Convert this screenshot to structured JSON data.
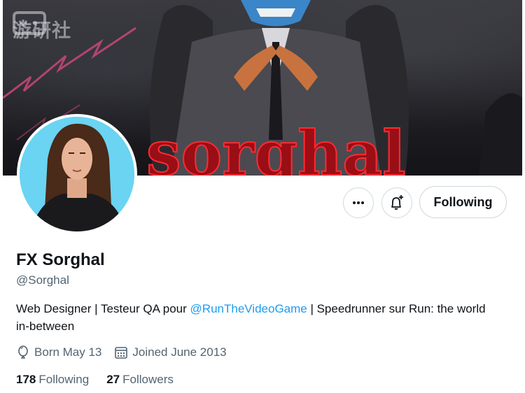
{
  "banner": {
    "watermark": "游研社",
    "title_art": "sorghal"
  },
  "profile": {
    "display_name": "FX Sorghal",
    "handle": "@Sorghal",
    "bio_prefix": "Web Designer | Testeur QA pour ",
    "bio_mention": "@RunTheVideoGame",
    "bio_suffix": " | Speedrunner sur Run: the world in-between",
    "birthday": "Born May 13",
    "joined": "Joined June 2013"
  },
  "actions": {
    "more_icon": "more-dots-icon",
    "notify_icon": "bell-plus-icon",
    "follow_label": "Following"
  },
  "stats": {
    "following_count": "178",
    "following_label": "Following",
    "followers_count": "27",
    "followers_label": "Followers"
  },
  "colors": {
    "link": "#1d9bf0",
    "secondary_text": "#536471",
    "avatar_bg": "#6ad4f2",
    "banner_text": "#c8141e"
  }
}
